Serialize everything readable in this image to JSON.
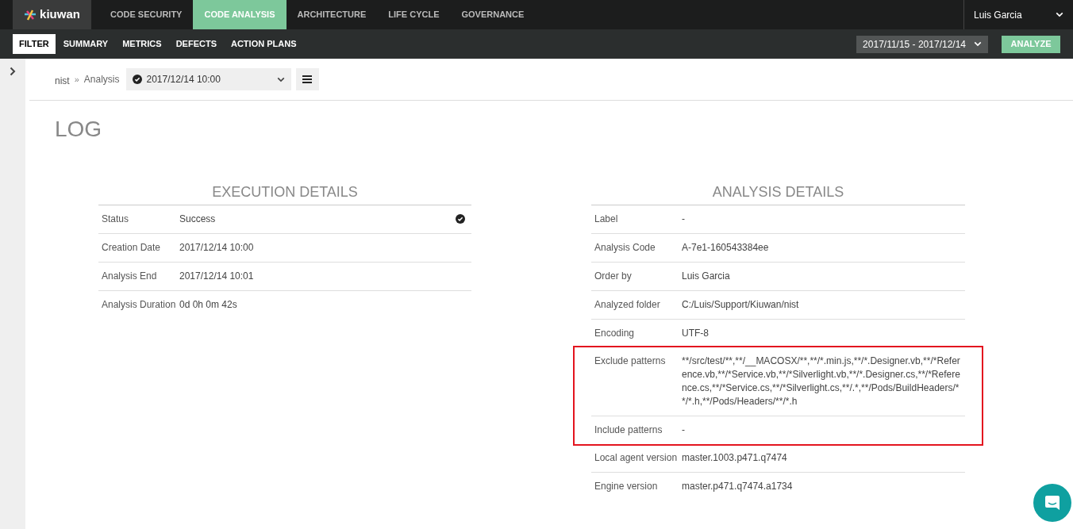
{
  "logo": {
    "text": "kiuwan"
  },
  "main_tabs": [
    {
      "label": "CODE SECURITY",
      "selected": false
    },
    {
      "label": "CODE ANALYSIS",
      "selected": true
    },
    {
      "label": "ARCHITECTURE",
      "selected": false
    },
    {
      "label": "LIFE CYCLE",
      "selected": false
    },
    {
      "label": "GOVERNANCE",
      "selected": false
    }
  ],
  "user_menu": {
    "name": "Luis Garcia"
  },
  "sub_tabs": [
    {
      "label": "FILTER",
      "selected": true
    },
    {
      "label": "SUMMARY",
      "selected": false
    },
    {
      "label": "METRICS",
      "selected": false
    },
    {
      "label": "DEFECTS",
      "selected": false
    },
    {
      "label": "ACTION PLANS",
      "selected": false
    }
  ],
  "date_range": {
    "value": "2017/11/15 - 2017/12/14"
  },
  "analyze_button": {
    "label": "ANALYZE"
  },
  "breadcrumb": {
    "app": "nist",
    "separator": "»",
    "page": "Analysis"
  },
  "analysis_select": {
    "value": "2017/12/14 10:00"
  },
  "page_title": "LOG",
  "execution_details": {
    "title": "EXECUTION DETAILS",
    "rows": [
      {
        "label": "Status",
        "value": "Success",
        "success": true
      },
      {
        "label": "Creation Date",
        "value": "2017/12/14 10:00",
        "success": false
      },
      {
        "label": "Analysis End",
        "value": "2017/12/14 10:01",
        "success": false
      },
      {
        "label": "Analysis Duration",
        "value": "0d 0h 0m 42s",
        "success": false
      }
    ]
  },
  "analysis_details": {
    "title": "ANALYSIS DETAILS",
    "rows": [
      {
        "label": "Label",
        "value": "-",
        "highlighted": false
      },
      {
        "label": "Analysis Code",
        "value": "A-7e1-160543384ee",
        "highlighted": false
      },
      {
        "label": "Order by",
        "value": "Luis Garcia",
        "highlighted": false
      },
      {
        "label": "Analyzed folder",
        "value": "C:/Luis/Support/Kiuwan/nist",
        "highlighted": false
      },
      {
        "label": "Encoding",
        "value": "UTF-8",
        "highlighted": false
      },
      {
        "label": "Exclude patterns",
        "value": "**/src/test/**,**/__MACOSX/**,**/*.min.js,**/*.Designer.vb,**/*Reference.vb,**/*Service.vb,**/*Silverlight.vb,**/*.Designer.cs,**/*Reference.cs,**/*Service.cs,**/*Silverlight.cs,**/.*,**/Pods/BuildHeaders/**/*.h,**/Pods/Headers/**/*.h",
        "highlighted": true
      },
      {
        "label": "Include patterns",
        "value": "-",
        "highlighted": true
      },
      {
        "label": "Local agent version",
        "value": "master.1003.p471.q7474",
        "highlighted": false
      },
      {
        "label": "Engine version",
        "value": "master.p471.q7474.a1734",
        "highlighted": false
      }
    ]
  }
}
